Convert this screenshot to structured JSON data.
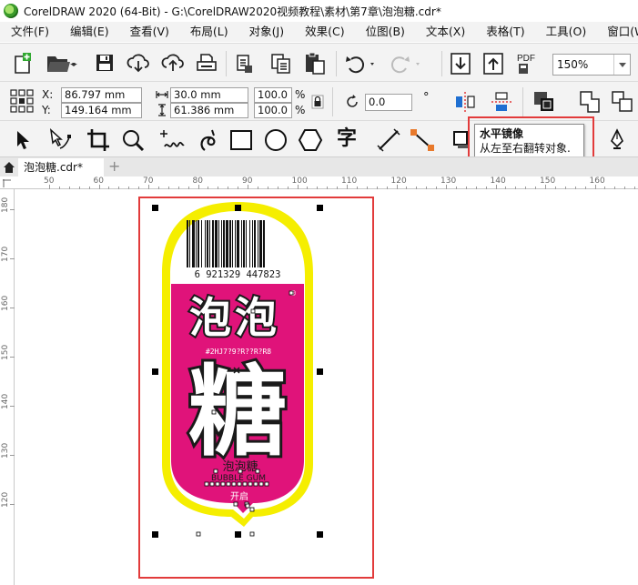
{
  "window": {
    "title": "CorelDRAW 2020 (64-Bit) - G:\\CorelDRAW2020视频教程\\素材\\第7章\\泡泡糖.cdr*"
  },
  "menu": [
    "文件(F)",
    "编辑(E)",
    "查看(V)",
    "布局(L)",
    "对象(J)",
    "效果(C)",
    "位图(B)",
    "文本(X)",
    "表格(T)",
    "工具(O)",
    "窗口(W)"
  ],
  "standard_toolbar": {
    "pdf_label": "PDF",
    "zoom": "150%"
  },
  "property_bar": {
    "x_label": "X:",
    "x_value": "86.797 mm",
    "y_label": "Y:",
    "y_value": "149.164 mm",
    "width_value": "30.0 mm",
    "height_value": "61.386 mm",
    "scale_x": "100.0",
    "scale_y": "100.0",
    "percent": "%",
    "rotation": "0.0",
    "degree": "°"
  },
  "toolbox": {
    "text_tool_label": "字"
  },
  "tooltip": {
    "title": "水平镜像",
    "description": "从左至右翻转对象."
  },
  "document_tab": {
    "label": "泡泡糖.cdr*",
    "add_label": "+"
  },
  "ruler_h": [
    "50",
    "60",
    "70",
    "80",
    "90",
    "100",
    "110",
    "120",
    "130",
    "140",
    "150",
    "160"
  ],
  "ruler_v": [
    "180",
    "170",
    "160",
    "150",
    "140",
    "130",
    "120"
  ],
  "design": {
    "barcode_number": "6 921329 447823",
    "word_top": "泡泡",
    "word_main": "糖",
    "small_line": "#2HJ7?9?R??R?R8",
    "subtitle": "泡泡糖",
    "subtitle_en": "BUBBLE GUM",
    "open_label": "开启",
    "registered": "®",
    "colors": {
      "outline": "#f5ee00",
      "body": "#e0137a",
      "ink": "#1a1a1a"
    }
  }
}
